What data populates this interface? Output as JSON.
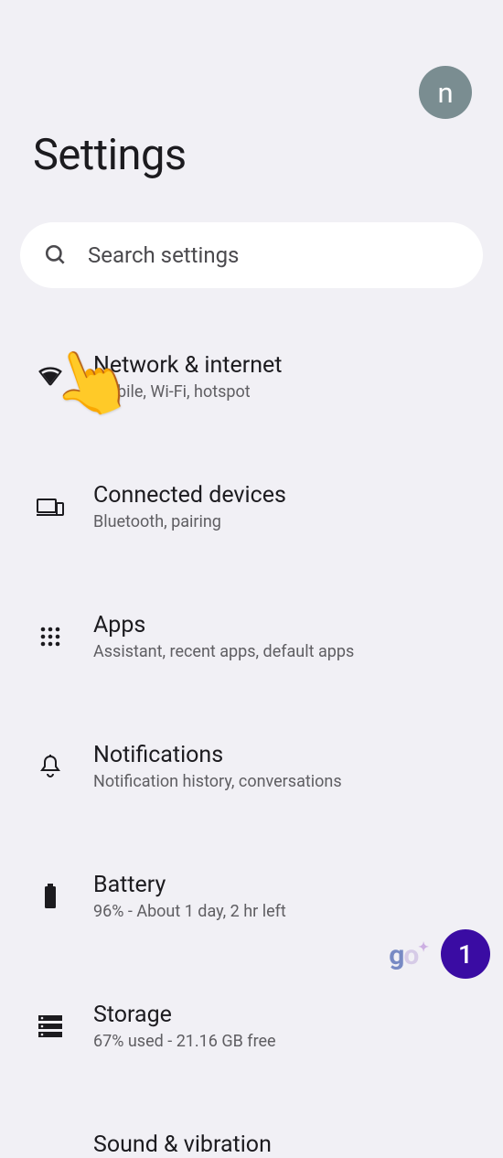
{
  "header": {
    "avatar_letter": "n",
    "title": "Settings"
  },
  "search": {
    "placeholder": "Search settings"
  },
  "items": [
    {
      "icon": "wifi",
      "title": "Network & internet",
      "sub": "Mobile, Wi-Fi, hotspot"
    },
    {
      "icon": "devices",
      "title": "Connected devices",
      "sub": "Bluetooth, pairing"
    },
    {
      "icon": "apps",
      "title": "Apps",
      "sub": "Assistant, recent apps, default apps"
    },
    {
      "icon": "notifications",
      "title": "Notifications",
      "sub": "Notification history, conversations"
    },
    {
      "icon": "battery",
      "title": "Battery",
      "sub": "96% - About 1 day, 2 hr left"
    },
    {
      "icon": "storage",
      "title": "Storage",
      "sub": "67% used - 21.16 GB free"
    },
    {
      "icon": "sound",
      "title": "Sound & vibration",
      "sub": ""
    }
  ],
  "overlay": {
    "go_text": "go",
    "badge_number": "1"
  }
}
